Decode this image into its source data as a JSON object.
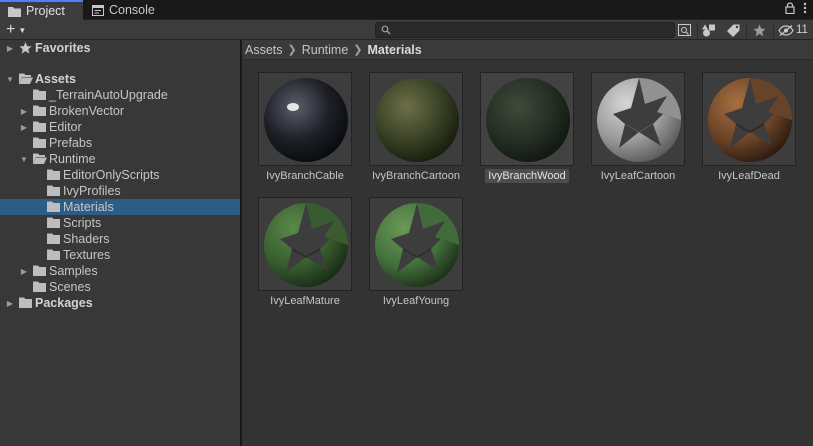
{
  "tabs": [
    {
      "label": "Project",
      "icon": "folder-icon",
      "active": true
    },
    {
      "label": "Console",
      "icon": "console-icon",
      "active": false
    }
  ],
  "toolbar": {
    "create_label": "+",
    "search_value": "",
    "hidden_count": "11"
  },
  "tree": {
    "favorites": "Favorites",
    "assets": "Assets",
    "items": [
      {
        "label": "_TerrainAutoUpgrade",
        "expandable": false,
        "expanded": false,
        "selected": false
      },
      {
        "label": "BrokenVector",
        "expandable": true,
        "expanded": false,
        "selected": false
      },
      {
        "label": "Editor",
        "expandable": true,
        "expanded": false,
        "selected": false
      },
      {
        "label": "Prefabs",
        "expandable": false,
        "expanded": false,
        "selected": false
      },
      {
        "label": "Runtime",
        "expandable": true,
        "expanded": true,
        "selected": false
      },
      {
        "label": "EditorOnlyScripts",
        "expandable": false,
        "expanded": false,
        "selected": false
      },
      {
        "label": "IvyProfiles",
        "expandable": false,
        "expanded": false,
        "selected": false
      },
      {
        "label": "Materials",
        "expandable": false,
        "expanded": false,
        "selected": true
      },
      {
        "label": "Scripts",
        "expandable": false,
        "expanded": false,
        "selected": false
      },
      {
        "label": "Shaders",
        "expandable": false,
        "expanded": false,
        "selected": false
      },
      {
        "label": "Textures",
        "expandable": false,
        "expanded": false,
        "selected": false
      },
      {
        "label": "Samples",
        "expandable": true,
        "expanded": false,
        "selected": false
      },
      {
        "label": "Scenes",
        "expandable": false,
        "expanded": false,
        "selected": false
      }
    ],
    "packages": "Packages"
  },
  "breadcrumb": [
    "Assets",
    "Runtime",
    "Materials"
  ],
  "assets": [
    {
      "label": "IvyBranchCable",
      "selected": false,
      "preview": "sphere",
      "colors": [
        "#5a5f6b",
        "#1e2026",
        "#08090b"
      ]
    },
    {
      "label": "IvyBranchCartoon",
      "selected": false,
      "preview": "sphere",
      "colors": [
        "#6b7046",
        "#3c4226",
        "#151a0c"
      ]
    },
    {
      "label": "IvyBranchWood",
      "selected": true,
      "preview": "sphere",
      "colors": [
        "#3e4a3b",
        "#263025",
        "#101510"
      ]
    },
    {
      "label": "IvyLeafCartoon",
      "selected": false,
      "preview": "leaf",
      "colors": [
        "#d6d6d6",
        "#9a9a9a",
        "#5a5a5a"
      ]
    },
    {
      "label": "IvyLeafDead",
      "selected": false,
      "preview": "leaf",
      "colors": [
        "#a86f40",
        "#6b4426",
        "#2d1a10"
      ]
    },
    {
      "label": "IvyLeafMature",
      "selected": false,
      "preview": "leaf",
      "colors": [
        "#5a8a4a",
        "#375e2e",
        "#172b14"
      ]
    },
    {
      "label": "IvyLeafYoung",
      "selected": false,
      "preview": "leaf",
      "colors": [
        "#6a9a58",
        "#41703a",
        "#1b3018"
      ]
    }
  ],
  "colors": {
    "accent": "#4c7eff",
    "selection": "#2c5d87"
  }
}
